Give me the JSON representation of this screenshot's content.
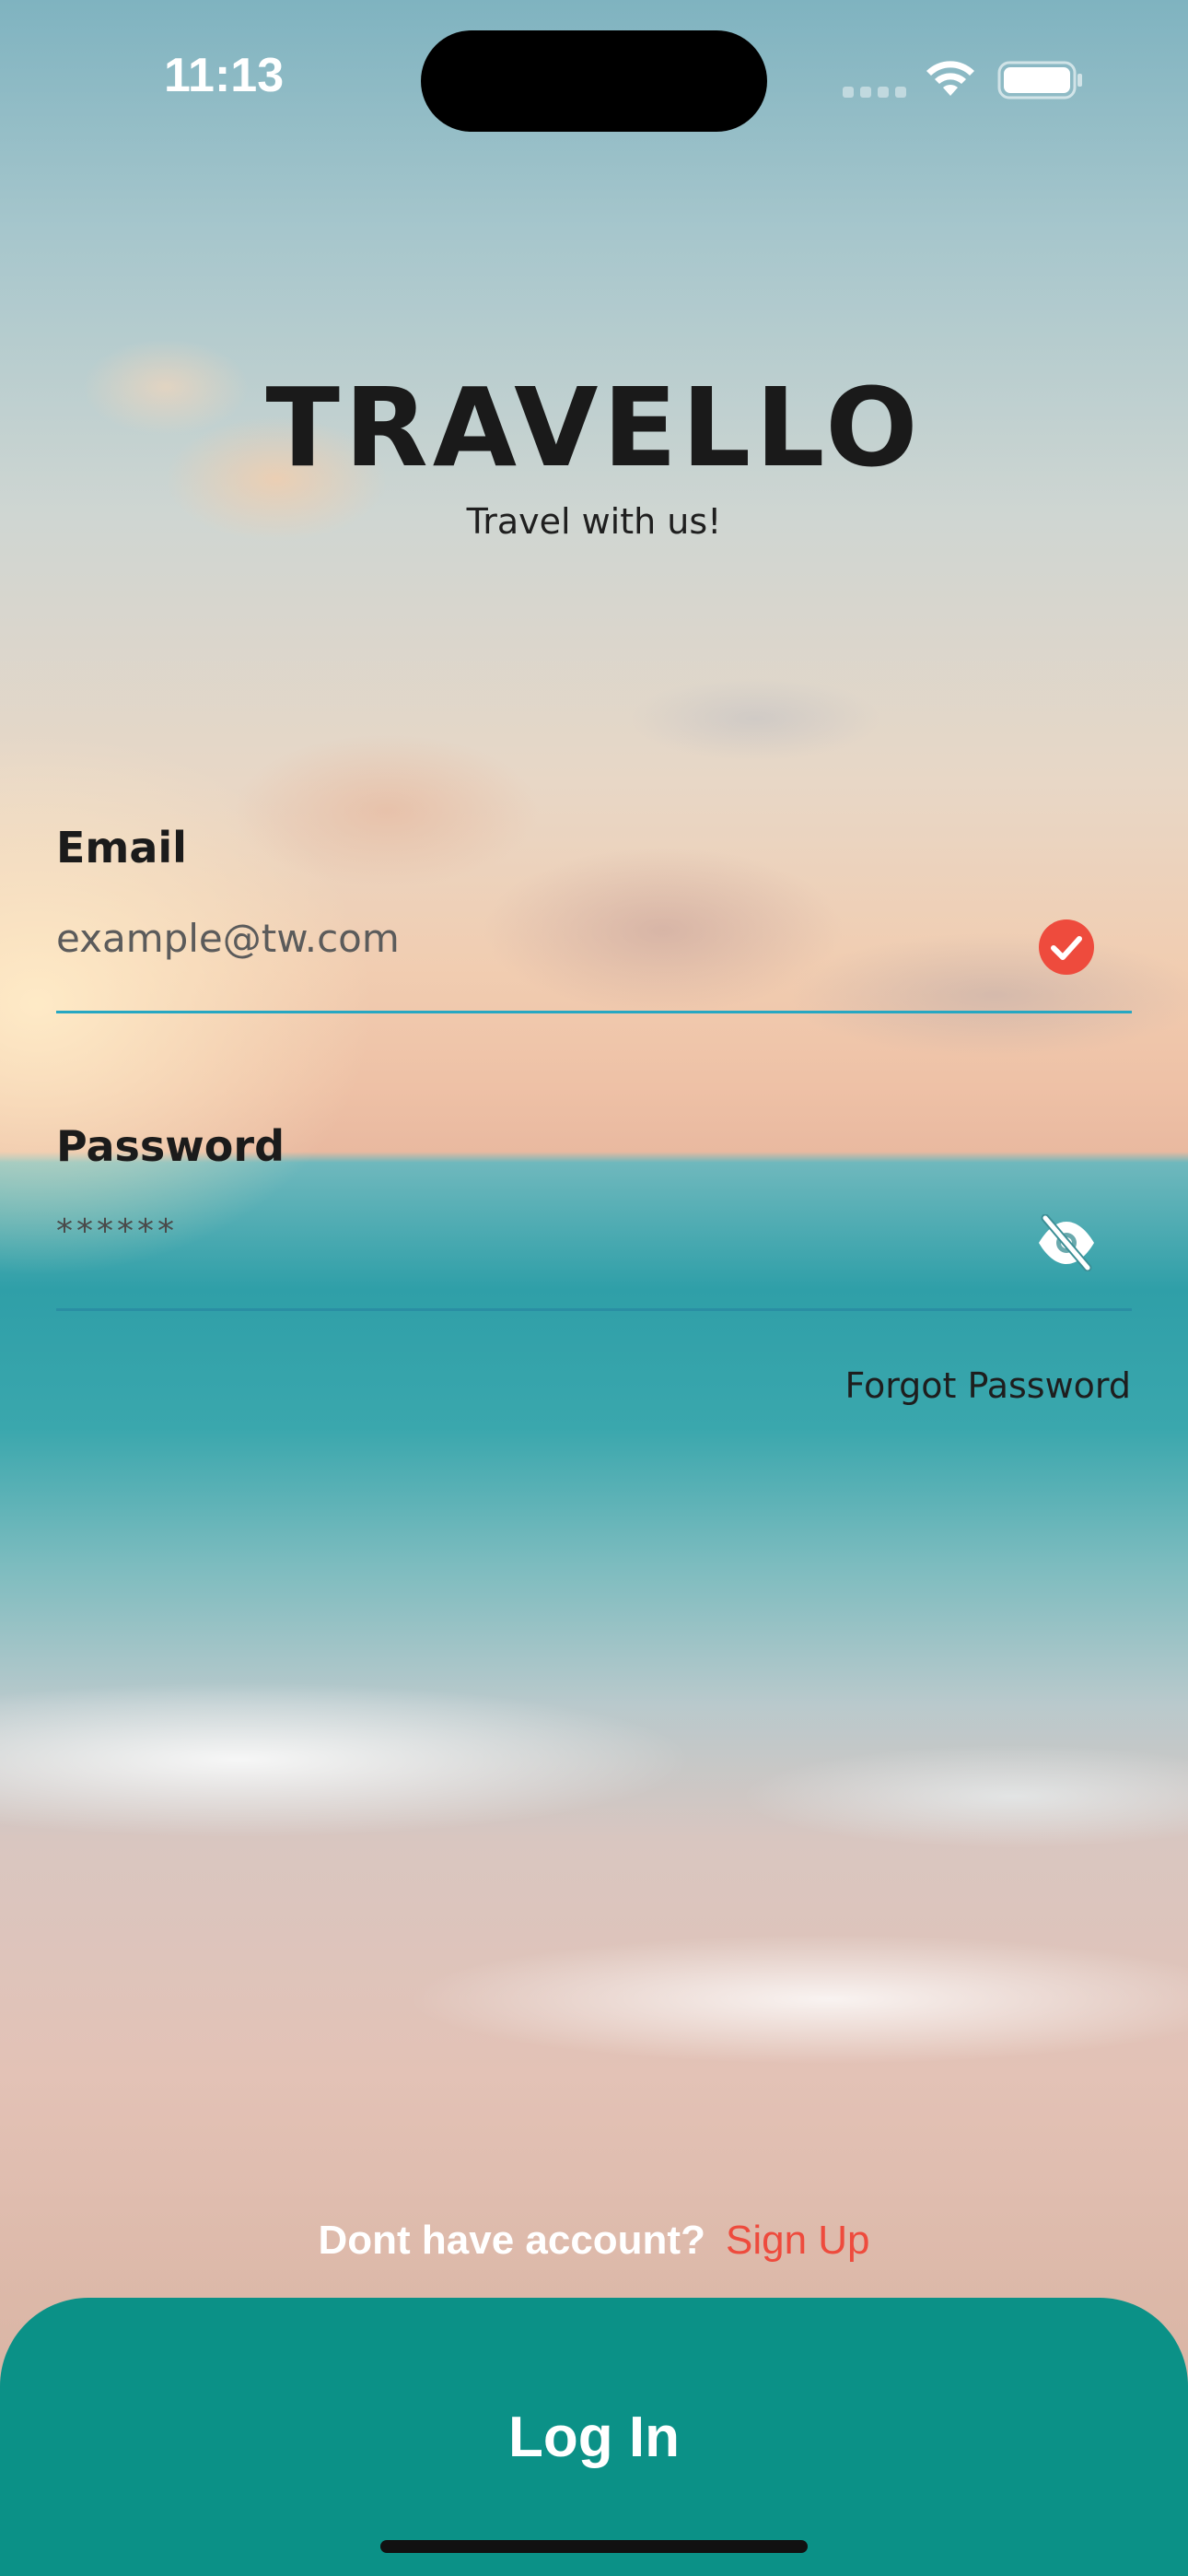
{
  "status_bar": {
    "time": "11:13",
    "icons": [
      "cellular-signal-icon",
      "wifi-icon",
      "battery-icon"
    ]
  },
  "brand": {
    "title": "TRAVELLO",
    "subtitle": "Travel with us!"
  },
  "form": {
    "email": {
      "label": "Email",
      "placeholder": "example@tw.com",
      "value": "",
      "valid_icon": "check-circle-icon"
    },
    "password": {
      "label": "Password",
      "value": "******",
      "toggle_icon": "eye-slash-icon"
    },
    "forgot_password": "Forgot Password"
  },
  "signup": {
    "prompt": "Dont have account?",
    "link": "Sign Up"
  },
  "login": {
    "label": "Log In"
  },
  "colors": {
    "accent": "#0b9187",
    "link_red": "#ee4b3d",
    "check_red": "#ee4b3d",
    "email_underline": "#26a7c2",
    "password_underline": "#2a8ea3"
  }
}
